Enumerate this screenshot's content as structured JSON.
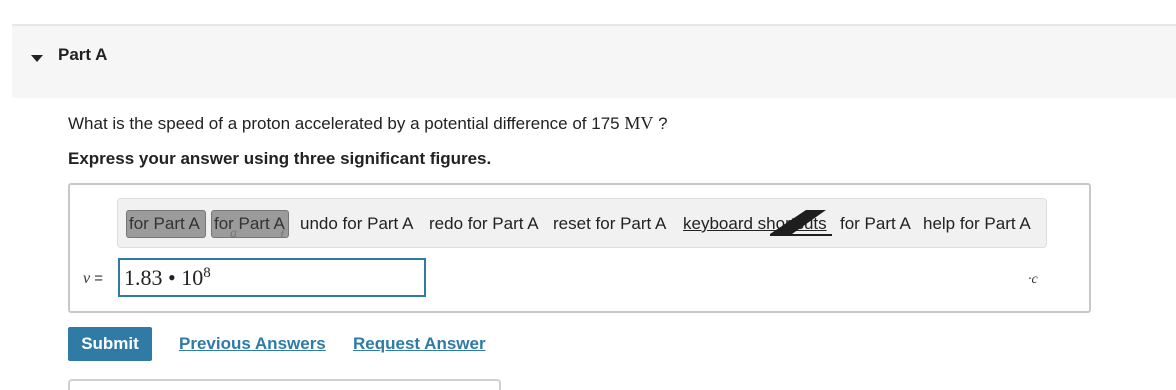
{
  "part": {
    "title": "Part A"
  },
  "question": {
    "text": "What is the speed of a proton accelerated by a potential difference of 175",
    "unit": "MV",
    "mark": "?"
  },
  "instruction": "Express your answer using three significant figures.",
  "toolbar": {
    "btn1": "for Part A",
    "btn2": "for Part A",
    "btn2_ghost_a": "a",
    "btn2_ghost_b": "f",
    "undo": "undo for Part A",
    "redo": "redo for Part A",
    "reset": "reset for Part A",
    "keyboard": "keyboard shortcuts",
    "keyboard_suffix": "for Part A",
    "help": "help for Part A"
  },
  "answer": {
    "variable": "v",
    "equals": "=",
    "mantissa": "1.83",
    "operator": "•",
    "base": "10",
    "exponent": "8",
    "unit": "·c"
  },
  "actions": {
    "submit": "Submit",
    "previous": "Previous Answers",
    "request": "Request Answer"
  }
}
